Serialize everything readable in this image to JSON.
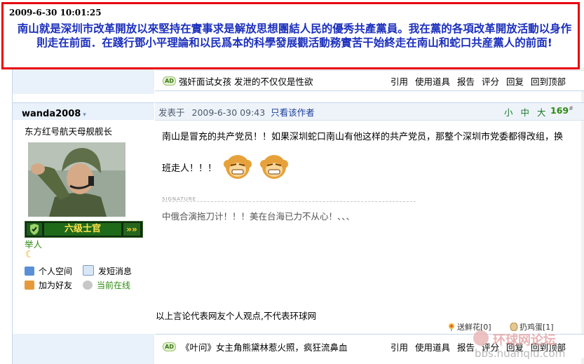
{
  "banner": {
    "timestamp": "2009-6-30 10:01:25",
    "message": "南山就是深圳市改革開放以來堅持在實事求是解放思想團結人民的優秀共產黨員。我在黨的各項改革開放活動以身作則走在前面．在踐行鄧小平理論和以民爲本的科學發展觀活動務實苦干始終走在南山和蛇口共産黨人的前面!"
  },
  "prev_post": {
    "ad_tag": "AD",
    "ad_text": "强奸面试女孩  发泄的不仅仅是性欲",
    "actions": [
      "引用",
      "使用道具",
      "报告",
      "评分",
      "回复",
      "回到顶部"
    ]
  },
  "user": {
    "name": "wanda2008",
    "title": "东方红号航天母舰舰长",
    "rank_label": "六级士官",
    "level": "举人",
    "links": [
      {
        "label": "个人空间",
        "icon": "home-icon"
      },
      {
        "label": "发短消息",
        "icon": "message-icon"
      },
      {
        "label": "加为好友",
        "icon": "add-friend-icon"
      },
      {
        "label": "当前在线",
        "icon": "online-user-icon"
      }
    ]
  },
  "post": {
    "posted_label": "发表于",
    "posted_time": "2009-6-30 09:43",
    "view_author": "只看该作者",
    "font_sizes": [
      "小",
      "中",
      "大"
    ],
    "floor": "169",
    "floor_sup": "#",
    "content": "南山是冒充的共产党员！！如果深圳蛇口南山有他这样的共产党员，那整个深圳市党委都得改组，换班走人！！！",
    "signature_label": "SIGNATURE",
    "signature": "中俄合演拖刀计！！！美在台海已力不从心！、、、",
    "disclaimer": "以上言论代表网友个人观点,不代表环球网",
    "gift_flower": "送鲜花[0]",
    "gift_egg": "扔鸡蛋[1]"
  },
  "next_post": {
    "ad_tag": "AD",
    "ad_text": "《叶问》女主角熊黛林惹火照，疯狂流鼻血",
    "actions": [
      "引用",
      "使用道具",
      "报告",
      "评分",
      "回复",
      "回到顶部"
    ]
  },
  "watermark": {
    "title": "环球网论坛",
    "url": "bbs.huanqiu.com"
  }
}
